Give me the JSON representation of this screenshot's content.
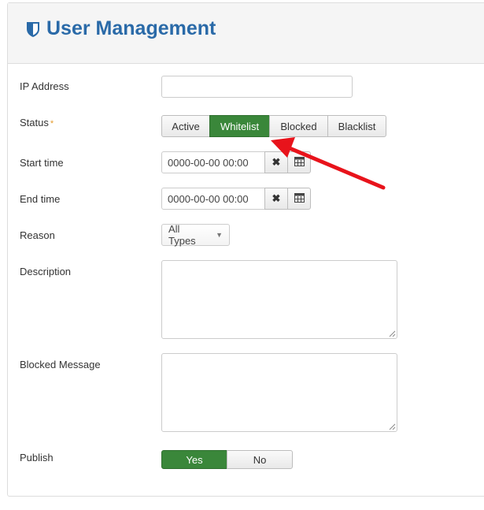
{
  "header": {
    "title": "User Management",
    "icon": "shield-icon",
    "title_color": "#2a6aa8"
  },
  "form": {
    "ip_address": {
      "label": "IP Address",
      "value": "",
      "placeholder": ""
    },
    "status": {
      "label": "Status",
      "required_mark": "*",
      "options": [
        "Active",
        "Whitelist",
        "Blocked",
        "Blacklist"
      ],
      "selected": "Whitelist"
    },
    "start_time": {
      "label": "Start time",
      "value": "0000-00-00 00:00"
    },
    "end_time": {
      "label": "End time",
      "value": "0000-00-00 00:00"
    },
    "reason": {
      "label": "Reason",
      "selected": "All Types"
    },
    "description": {
      "label": "Description",
      "value": ""
    },
    "blocked_message": {
      "label": "Blocked Message",
      "value": ""
    },
    "publish": {
      "label": "Publish",
      "options": [
        "Yes",
        "No"
      ],
      "selected": "Yes"
    }
  },
  "colors": {
    "active_green": "#3a873a",
    "annotation_red": "#e8131b",
    "required_orange": "#e59b2c"
  }
}
